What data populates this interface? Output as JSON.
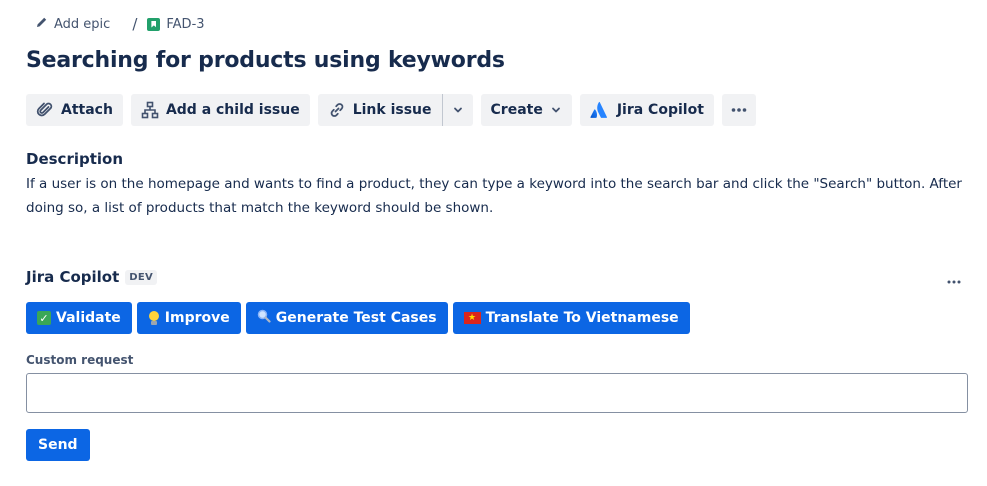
{
  "breadcrumb": {
    "epic_label": "Add epic",
    "separator": "/",
    "issue_key": "FAD-3"
  },
  "title": "Searching for products using keywords",
  "toolbar": {
    "attach": "Attach",
    "add_child": "Add a child issue",
    "link_issue": "Link issue",
    "create": "Create",
    "copilot": "Jira Copilot"
  },
  "description": {
    "heading": "Description",
    "text": "If a user is on the homepage and wants to find a product, they can type a keyword into the search bar and click the \"Search\" button. After doing so, a list of products that match the keyword should be shown."
  },
  "copilot_panel": {
    "title": "Jira Copilot",
    "badge": "DEV",
    "actions": {
      "validate": "Validate",
      "improve": "Improve",
      "generate": "Generate Test Cases",
      "translate": "Translate To Vietnamese"
    },
    "custom_request_label": "Custom request",
    "custom_request_value": "",
    "send": "Send"
  },
  "colors": {
    "primary": "#0c66e4",
    "neutral_button": "#f1f2f4",
    "text": "#172b4d",
    "story_icon": "#22a06b"
  },
  "icons": {
    "epic": "pencil-icon",
    "story": "story-icon",
    "attach": "paperclip-icon",
    "child": "hierarchy-icon",
    "link": "link-icon",
    "chevron": "chevron-down-icon",
    "copilot": "atlassian-logo-icon",
    "more": "more-icon"
  }
}
